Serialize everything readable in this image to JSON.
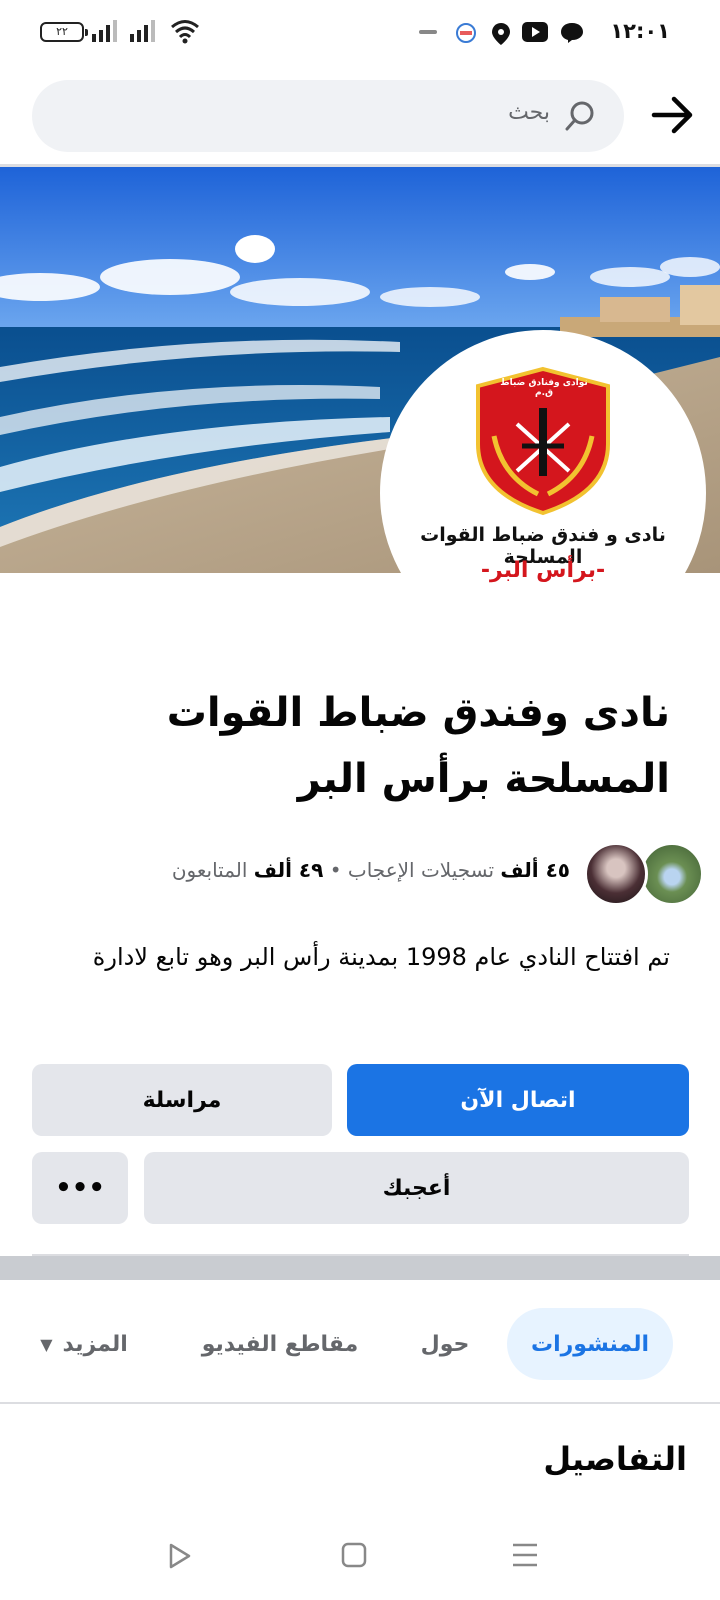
{
  "status_bar": {
    "time": "١٢:٠١",
    "battery": "٢٢"
  },
  "header": {
    "search_placeholder": "بحث"
  },
  "cover": {
    "logo_line_1": "نادى و فندق ضباط القوات المسلحة",
    "logo_line_2": "-برأس البر-",
    "shield_text": "نوادى وفنادق ضباط ق.م"
  },
  "page": {
    "title": "نادى وفندق ضباط القوات المسلحة برأس البر",
    "likes_count": "٤٥ ألف",
    "likes_label": "تسجيلات الإعجاب",
    "separator": "•",
    "followers_count": "٤٩ ألف",
    "followers_label": "المتابعون",
    "intro": "تم افتتاح النادي عام 1998 بمدينة رأس البر وهو تابع لادارة"
  },
  "actions": {
    "call": "اتصال الآن",
    "message": "مراسلة",
    "like": "أعجبك",
    "more": "•••"
  },
  "tabs": {
    "posts": "المنشورات",
    "about": "حول",
    "videos": "مقاطع الفيديو",
    "more": "المزيد"
  },
  "details": {
    "heading": "التفاصيل"
  },
  "colors": {
    "accent": "#1b74e4",
    "button_grey": "#e4e6eb",
    "tab_active_bg": "#e7f3ff",
    "shield_red": "#d4161d",
    "shield_gold": "#f2c230"
  }
}
